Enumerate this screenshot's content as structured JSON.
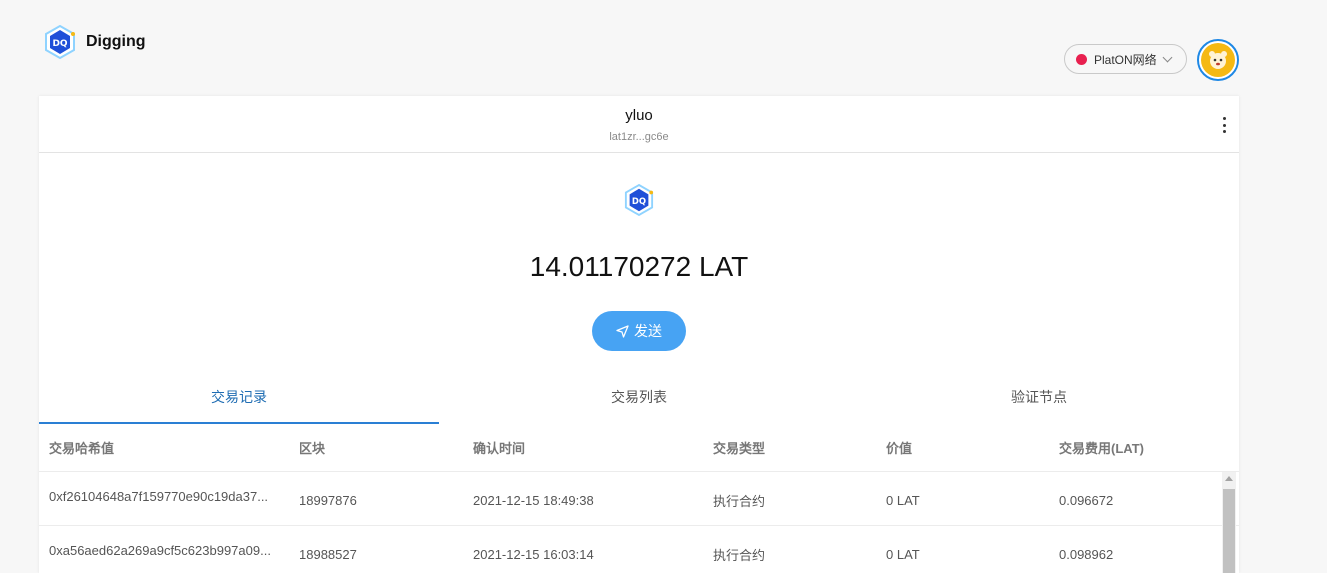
{
  "app": {
    "name": "Digging"
  },
  "network": {
    "label": "PlatON网络",
    "status_color": "#e8204f"
  },
  "account": {
    "name": "yluo",
    "address": "lat1zr...gc6e"
  },
  "wallet": {
    "balance": "14.01170272 LAT",
    "send_label": "发送"
  },
  "tabs": [
    {
      "label": "交易记录",
      "active": true
    },
    {
      "label": "交易列表",
      "active": false
    },
    {
      "label": "验证节点",
      "active": false
    }
  ],
  "table": {
    "headers": [
      "交易哈希值",
      "区块",
      "确认时间",
      "交易类型",
      "价值",
      "交易费用(LAT)"
    ],
    "rows": [
      [
        "0xf26104648a7f159770e90c19da37...",
        "18997876",
        "2021-12-15 18:49:38",
        "执行合约",
        "0 LAT",
        "0.096672"
      ],
      [
        "0xa56aed62a269a9cf5c623b997a09...",
        "18988527",
        "2021-12-15 16:03:14",
        "执行合约",
        "0 LAT",
        "0.098962"
      ]
    ]
  },
  "icons": {
    "brand": "digging-logo-icon",
    "token": "digging-token-icon",
    "send": "send-arrow-icon",
    "more": "more-vertical-icon",
    "chevron": "chevron-down-icon"
  },
  "colors": {
    "accent": "#47a3f3",
    "tab_active": "#1f6db3",
    "avatar_ring": "#1e88e5"
  }
}
